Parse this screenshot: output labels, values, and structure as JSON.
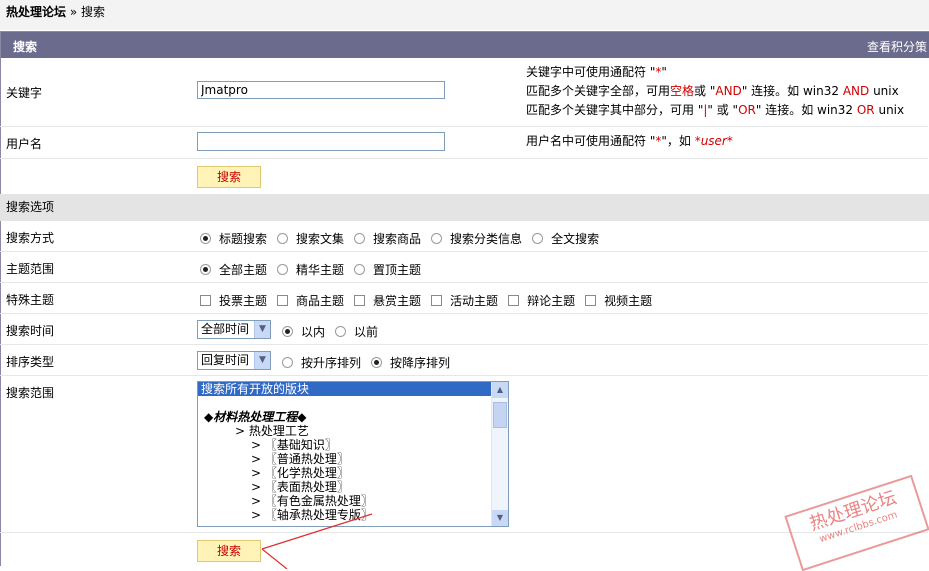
{
  "breadcrumb": {
    "forum": "热处理论坛",
    "sep": "»",
    "page": "搜索"
  },
  "header": {
    "title": "搜索",
    "link": "查看积分策"
  },
  "keyword": {
    "label": "关键字",
    "value": "Jmatpro",
    "hint1_a": "关键字中可使用通配符 \"",
    "hint1_b": "*",
    "hint1_c": "\"",
    "hint2_a": "匹配多个关键字全部，可用",
    "hint2_b": "空格",
    "hint2_c": "或 \"",
    "hint2_d": "AND",
    "hint2_e": "\" 连接。如 win32 ",
    "hint2_f": "AND",
    "hint2_g": " unix",
    "hint3_a": "匹配多个关键字其中部分，可用 \"",
    "hint3_b": "|",
    "hint3_c": "\" 或 \"",
    "hint3_d": "OR",
    "hint3_e": "\" 连接。如 win32 ",
    "hint3_f": "OR",
    "hint3_g": " unix"
  },
  "username": {
    "label": "用户名",
    "value": "",
    "hint_a": "用户名中可使用通配符 \"",
    "hint_b": "*",
    "hint_c": "\"，如 ",
    "hint_d": "*user*"
  },
  "search_button": "搜索",
  "options_section": "搜索选项",
  "search_mode": {
    "label": "搜索方式",
    "options": [
      "标题搜索",
      "搜索文集",
      "搜索商品",
      "搜索分类信息",
      "全文搜索"
    ],
    "selected": 0
  },
  "topic_scope": {
    "label": "主题范围",
    "options": [
      "全部主题",
      "精华主题",
      "置顶主题"
    ],
    "selected": 0
  },
  "special": {
    "label": "特殊主题",
    "options": [
      "投票主题",
      "商品主题",
      "悬赏主题",
      "活动主题",
      "辩论主题",
      "视频主题"
    ]
  },
  "time": {
    "label": "搜索时间",
    "select": "全部时间",
    "options": [
      "以内",
      "以前"
    ],
    "selected": 0
  },
  "sort": {
    "label": "排序类型",
    "select": "回复时间",
    "options": [
      "按升序排列",
      "按降序排列"
    ],
    "selected": 1
  },
  "scope": {
    "label": "搜索范围",
    "items": [
      "搜索所有开放的版块",
      "",
      "◆材料热处理工程◆",
      "> 热处理工艺",
      "> 〖基础知识〗",
      "> 〖普通热处理〗",
      "> 〖化学热处理〗",
      "> 〖表面热处理〗",
      "> 〖有色金属热处理〗",
      "> 〖轴承热处理专版〗"
    ]
  },
  "watermark": {
    "main": "热处理论坛",
    "sub": "www.rclbbs.com"
  },
  "colors": {
    "header_bg": "#6b6b8e",
    "button_bg": "#fff3b8",
    "button_text": "#c00000",
    "accent_red": "#d00000"
  }
}
